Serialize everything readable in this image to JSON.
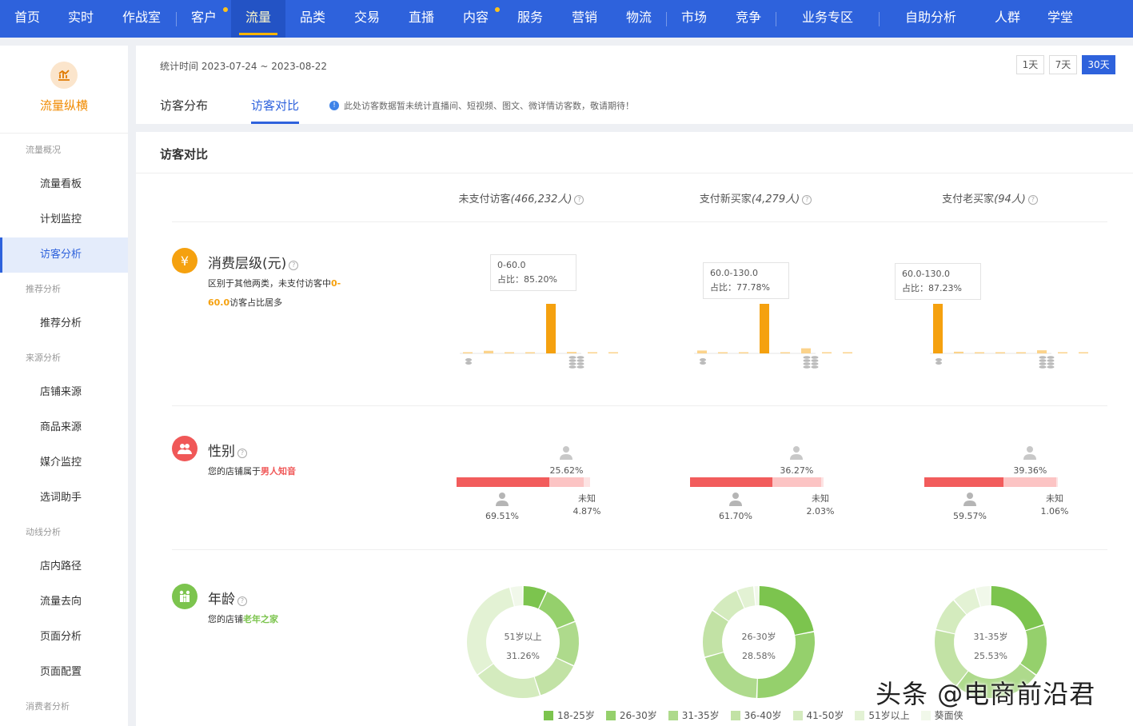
{
  "nav": {
    "items": [
      {
        "label": "首页",
        "dot": false,
        "active": false
      },
      {
        "label": "实时",
        "dot": false,
        "active": false
      },
      {
        "label": "作战室",
        "dot": false,
        "active": false
      },
      {
        "label": "客户",
        "dot": true,
        "active": false
      },
      {
        "label": "流量",
        "dot": false,
        "active": true
      },
      {
        "label": "品类",
        "dot": false,
        "active": false
      },
      {
        "label": "交易",
        "dot": false,
        "active": false
      },
      {
        "label": "直播",
        "dot": false,
        "active": false
      },
      {
        "label": "内容",
        "dot": true,
        "active": false
      },
      {
        "label": "服务",
        "dot": false,
        "active": false
      },
      {
        "label": "营销",
        "dot": false,
        "active": false
      },
      {
        "label": "物流",
        "dot": false,
        "active": false
      },
      {
        "label": "市场",
        "dot": false,
        "active": false
      },
      {
        "label": "竞争",
        "dot": false,
        "active": false
      },
      {
        "label": "业务专区",
        "dot": false,
        "active": false
      },
      {
        "label": "自助分析",
        "dot": false,
        "active": false
      },
      {
        "label": "人群",
        "dot": false,
        "active": false
      },
      {
        "label": "学堂",
        "dot": false,
        "active": false
      }
    ]
  },
  "sidebar": {
    "logo_text": "流量纵横",
    "sections": [
      {
        "group": "流量概况",
        "items": [
          {
            "label": "流量看板",
            "active": false
          },
          {
            "label": "计划监控",
            "active": false
          },
          {
            "label": "访客分析",
            "active": true
          }
        ]
      },
      {
        "group": "推荐分析",
        "items": [
          {
            "label": "推荐分析",
            "active": false
          }
        ]
      },
      {
        "group": "来源分析",
        "items": [
          {
            "label": "店铺来源",
            "active": false
          },
          {
            "label": "商品来源",
            "active": false
          },
          {
            "label": "媒介监控",
            "active": false
          },
          {
            "label": "选词助手",
            "active": false
          }
        ]
      },
      {
        "group": "动线分析",
        "items": [
          {
            "label": "店内路径",
            "active": false
          },
          {
            "label": "流量去向",
            "active": false
          },
          {
            "label": "页面分析",
            "active": false
          },
          {
            "label": "页面配置",
            "active": false
          }
        ]
      },
      {
        "group": "消费者分析",
        "items": []
      }
    ]
  },
  "header": {
    "stat_time": "统计时间 2023-07-24 ~ 2023-08-22",
    "ranges": [
      {
        "label": "1天",
        "active": false
      },
      {
        "label": "7天",
        "active": false
      },
      {
        "label": "30天",
        "active": true
      }
    ],
    "tabs": [
      {
        "label": "访客分布",
        "active": false
      },
      {
        "label": "访客对比",
        "active": true
      }
    ],
    "notice": "此处访客数据暂未统计直播间、短视频、图文、微详情访客数，敬请期待！"
  },
  "main": {
    "title": "访客对比",
    "columns": [
      {
        "name": "未支付访客",
        "count": "(466,232人)"
      },
      {
        "name": "支付新买家",
        "count": "(4,279人)"
      },
      {
        "name": "支付老买家",
        "count": "(94人)"
      }
    ],
    "consumption": {
      "title": "消费层级(元)",
      "desc_prefix": "区别于其他两类，未支付访客中",
      "desc_highlight": "0-60.0",
      "desc_suffix": "访客占比居多",
      "tips": [
        {
          "range": "0-60.0",
          "ratio": "占比：85.20%"
        },
        {
          "range": "60.0-130.0",
          "ratio": "占比：77.78%"
        },
        {
          "range": "60.0-130.0",
          "ratio": "占比：87.23%"
        }
      ]
    },
    "gender": {
      "title": "性别",
      "desc_prefix": "您的店铺属于",
      "desc_highlight": "男人知音",
      "columns": [
        {
          "male": "69.51%",
          "female": "25.62%",
          "unknown_label": "未知",
          "unknown": "4.87%"
        },
        {
          "male": "61.70%",
          "female": "36.27%",
          "unknown_label": "未知",
          "unknown": "2.03%"
        },
        {
          "male": "59.57%",
          "female": "39.36%",
          "unknown_label": "未知",
          "unknown": "1.06%"
        }
      ]
    },
    "age": {
      "title": "年龄",
      "desc_prefix": "您的店铺",
      "desc_highlight": "老年之家",
      "centers": [
        {
          "label": "51岁以上",
          "value": "31.26%"
        },
        {
          "label": "26-30岁",
          "value": "28.58%"
        },
        {
          "label": "31-35岁",
          "value": "25.53%"
        }
      ],
      "legend": [
        "18-25岁",
        "26-30岁",
        "31-35岁",
        "36-40岁",
        "41-50岁",
        "51岁以上",
        "葵面侠"
      ]
    }
  },
  "chart_data": [
    {
      "type": "bar",
      "title": "未支付访客",
      "categories": [
        "1",
        "2",
        "3",
        "4",
        "5",
        "6",
        "7",
        "8"
      ],
      "values": [
        1.5,
        4.5,
        1.5,
        1.5,
        85.2,
        2.5,
        1.0,
        1.0
      ],
      "highlight_index": 4
    },
    {
      "type": "bar",
      "title": "支付新买家",
      "categories": [
        "1",
        "2",
        "3",
        "4",
        "5",
        "6",
        "7",
        "8"
      ],
      "values": [
        4.5,
        1.5,
        1.0,
        77.78,
        1.0,
        8.0,
        1.0,
        1.0
      ],
      "highlight_index": 3
    },
    {
      "type": "bar",
      "title": "支付老买家",
      "categories": [
        "1",
        "2",
        "3",
        "4",
        "5",
        "6",
        "7",
        "8"
      ],
      "values": [
        87.23,
        3.0,
        1.0,
        1.0,
        1.0,
        5.5,
        1.0,
        1.0
      ],
      "highlight_index": 0
    },
    {
      "type": "pie",
      "title": "未支付访客",
      "labels": [
        "18-25岁",
        "26-30岁",
        "31-35岁",
        "36-40岁",
        "41-50岁",
        "51岁以上",
        "葵面侠"
      ],
      "values": [
        7,
        12,
        13,
        13,
        20,
        31.26,
        3.74
      ]
    },
    {
      "type": "pie",
      "title": "支付新买家",
      "labels": [
        "18-25岁",
        "26-30岁",
        "31-35岁",
        "36-40岁",
        "41-50岁",
        "51岁以上",
        "葵面侠"
      ],
      "values": [
        22,
        28.58,
        20,
        14,
        9,
        5,
        1.42
      ]
    },
    {
      "type": "pie",
      "title": "支付老买家",
      "labels": [
        "18-25岁",
        "26-30岁",
        "31-35岁",
        "36-40岁",
        "41-50岁",
        "51岁以上",
        "葵面侠"
      ],
      "values": [
        20,
        15,
        25.53,
        18,
        10,
        7,
        4.47
      ]
    }
  ],
  "colors": {
    "primary": "#2e62dc",
    "orange": "#f5a10f",
    "bar_light": "#fbd38b",
    "male": "#f25c5c",
    "female": "#fcc4c4",
    "age": [
      "#7cc44e",
      "#95d06c",
      "#aeda8c",
      "#c2e2a5",
      "#d4ebbe",
      "#e3f2d4",
      "#f1f8ea"
    ]
  },
  "watermark": "头条 @电商前沿君"
}
